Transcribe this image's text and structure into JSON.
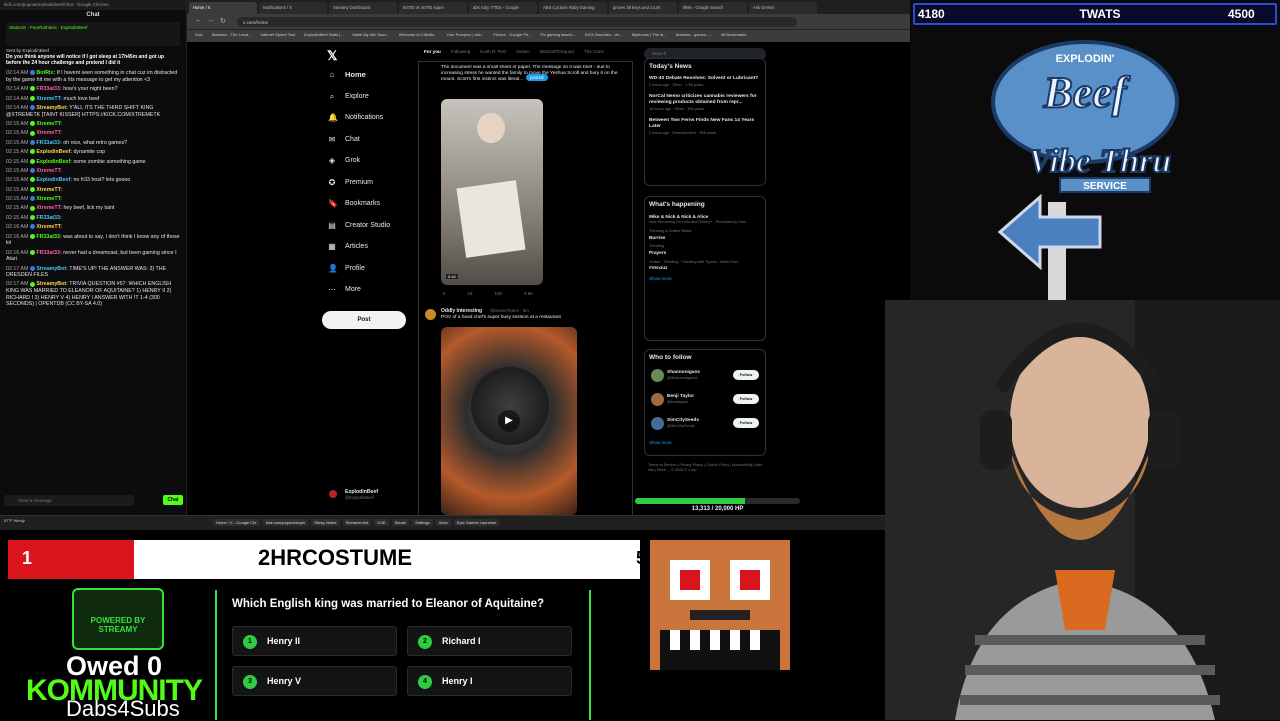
{
  "chat": {
    "url": "kick.com/popout/explodinbeef/chat - Google Chrome",
    "title": "Chat",
    "pinned": [
      "StationS",
      "FearRuthless",
      "ExplodinBeef"
    ],
    "sent_by": "Sent by ExplodinBeef",
    "pinned_text": "Do you think anyone will notice if I got sleep at 17h45m and got up before the 24 hour challenge and pretend I did it",
    "messages": [
      {
        "time": "02:14 AM",
        "user": "BotRix:",
        "text": "If I havent seen something in chat cuz im distracted by the game hit me with a !its message to get my attention <3"
      },
      {
        "time": "02:14 AM",
        "user": "FR33at33:",
        "text": "how's your night been?"
      },
      {
        "time": "02:14 AM",
        "user": "XtremeTT:",
        "text": "much love beef"
      },
      {
        "time": "02:14 AM",
        "user": "StreamyBot:",
        "text": "Y'ALL ITS THE THIRD SHIFT KING @XTREMETK [TAINT KISSER] HTTPS://KICK.COM/XTREMETK"
      },
      {
        "time": "02:15 AM",
        "user": "XtremeTT:",
        "text": ""
      },
      {
        "time": "02:15 AM",
        "user": "XtremeTT:",
        "text": ""
      },
      {
        "time": "02:15 AM",
        "user": "FR33at33:",
        "text": "oh nice, what retro games?"
      },
      {
        "time": "02:15 AM",
        "user": "ExplodinBeef:",
        "text": "dynamite cop"
      },
      {
        "time": "02:15 AM",
        "user": "ExplodinBeef:",
        "text": "some zombie something game"
      },
      {
        "time": "02:15 AM",
        "user": "XtremeTT:",
        "text": ""
      },
      {
        "time": "02:15 AM",
        "user": "ExplodinBeef:",
        "text": "no fr33 host? lets goooo"
      },
      {
        "time": "02:15 AM",
        "user": "XtremeTT:",
        "text": ""
      },
      {
        "time": "02:15 AM",
        "user": "XtremeTT:",
        "text": ""
      },
      {
        "time": "02:15 AM",
        "user": "XtremeTT:",
        "text": "hey beef, lick my taint"
      },
      {
        "time": "02:15 AM",
        "user": "FR33at33:",
        "text": ""
      },
      {
        "time": "02:16 AM",
        "user": "XtremeTT:",
        "text": ""
      },
      {
        "time": "02:16 AM",
        "user": "FR33at33:",
        "text": "was about to say, I don't think I know any of those lol"
      },
      {
        "time": "02:16 AM",
        "user": "FR33at33:",
        "text": "never had a dreamcast, but been gaming since I Atari"
      },
      {
        "time": "02:17 AM",
        "user": "StreamyBot:",
        "text": "TIME'S UP! THE ANSWER WAS: 3) THE DRESDEN FILES"
      },
      {
        "time": "02:17 AM",
        "user": "StreamyBot:",
        "text": "TRIVIA QUESTION #57: WHICH ENGLISH KING WAS MARRIED TO ELEANOR OF AQUITAINE? 1) HENRY II 2) RICHARD I 3) HENRY V 4) HENRY I ANSWER WITH !T 1-4 (300 SECONDS) | OPENTDB (CC BY-SA 4.0)"
      }
    ],
    "input_placeholder": "Send a message",
    "send_label": "Chat"
  },
  "browser": {
    "tabs": [
      "Home / X",
      "Notifications / X",
      "Streamy Dashboard",
      "5070ti vs 4070ti super",
      "abs ruby 7700x - Google",
      "ABS Cyclone Ruby Gaming",
      "gnives 38 keys and count",
      "ll99s - Google Search",
      "Ask Gemini"
    ],
    "url": "x.com/home",
    "bookmarks": [
      "Kick",
      "Statusus - The Lowd...",
      "Internet Speed Test",
      "ExplodinBeef Stats |...",
      "Make My Mix Soun...",
      "Welcome to Cliitutio...",
      "Your Pureplus | dsk...",
      "Photos - Google Ph...",
      "Fix gaming issues...",
      "KICK Bounties - vie...",
      "Mystronic | The la...",
      "Andreas - games -...",
      "All Bookmarks"
    ]
  },
  "x": {
    "nav": [
      "Home",
      "Explore",
      "Notifications",
      "Chat",
      "Grok",
      "Premium",
      "Bookmarks",
      "Creator Studio",
      "Articles",
      "Profile",
      "More"
    ],
    "post_label": "Post",
    "profile_name": "ExplodinBeef",
    "profile_handle": "@ExplodinBeef",
    "feed_tabs": [
      "For you",
      "Following",
      "Kush N' Test",
      "Autism",
      "Butch4PDSquad",
      "The Conn"
    ],
    "post1": {
      "text": "The document was a small sheet of paper. The message on it was brief - due to increasing stress he wanted the family to move the Yeshua Scroll and bury it on the mount. Scott's first instinct was literal...",
      "posted_label": "posted",
      "duration": "0:44",
      "stats": [
        "6",
        "18",
        "100",
        "3.6K"
      ]
    },
    "post2": {
      "author": "Oddly Interesting",
      "handle": "@DesireToSee · 5m",
      "text": "POV of a head chef's super busy session at a restaurant"
    },
    "search_placeholder": "Search",
    "today": {
      "title": "Today's News",
      "items": [
        {
          "headline": "WD-40 Debate Resolves: Solvent or Lubricant?",
          "meta": "2 hours ago · Other · 1.5K posts"
        },
        {
          "headline": "NorCal Nemo criticizes cannabis reviewers for reviewing products obtained from repr...",
          "meta": "16 hours ago · Other · 465 posts"
        },
        {
          "headline": "Between Two Ferns Finds New Fans 14 Years Later",
          "meta": "2 hours ago · Entertainment · 506 posts"
        }
      ]
    },
    "happening": {
      "title": "What's happening",
      "items": [
        {
          "title": "Mike & Nick & Nick & Alice",
          "meta": "Now Streaming On Hulu and Disney+ · Promoted by Hulu"
        },
        {
          "title": "Burries",
          "meta": "Trending in United States"
        },
        {
          "title": "Prayers",
          "meta": "Trending"
        },
        {
          "title": "#Venzuz",
          "meta": "Vtuber · Trending · Trending with Tyreee, Jamie Foxx"
        }
      ],
      "show_more": "Show more"
    },
    "who_to_follow": {
      "title": "Who to follow",
      "people": [
        {
          "name": "Shannonigans",
          "handle": "@ShannonigansX"
        },
        {
          "name": "Benji Taylor",
          "handle": "@benjitaylor"
        },
        {
          "name": "SimCitySeeds",
          "handle": "@SimCitySeeds"
        }
      ],
      "follow_label": "Follow",
      "show_more": "Show more"
    },
    "footer": "Terms of Service | Privacy Policy | Cookie Policy | Accessibility | Ads info | More ... © 2025 X Corp."
  },
  "hp": {
    "text": "13,313 / 20,000 HP",
    "current": 13313,
    "max": 20000
  },
  "taskbar": {
    "weather": "57°F Windy",
    "apps": [
      "Home / X - Google Chr",
      "kick.com/popout/explo",
      "Sticky Notes",
      "Streamer.bot",
      "KUE",
      "Steam",
      "Settings",
      "Xbox",
      "Epic Games Launcher"
    ],
    "clock": ""
  },
  "overlay": {
    "score_left": "4180",
    "score_title": "TWATS",
    "score_right": "4500",
    "logo_line1": "EXPLODIN'",
    "logo_line2": "Beef",
    "logo_line3": "Vibe Thru",
    "logo_line4": "SERVICE"
  },
  "trivia": {
    "rank": "1",
    "code": "2HRCOSTUME",
    "right_num": "5",
    "streamy_label": "POWERED BY STREAMY",
    "owed": "Owed 0",
    "kommunity": "KOMMUNITY",
    "dabs": "Dabs4Subs",
    "question": "Which English king was married to Eleanor of Aquitaine?",
    "answers": [
      {
        "num": "1",
        "text": "Henry II"
      },
      {
        "num": "2",
        "text": "Richard I"
      },
      {
        "num": "3",
        "text": "Henry V"
      },
      {
        "num": "4",
        "text": "Henry I"
      }
    ]
  },
  "colors": {
    "kick_green": "#53fc18",
    "x_blue": "#1d9bf0",
    "trivia_red": "#d9141c",
    "score_blue": "#2a4ad8"
  }
}
